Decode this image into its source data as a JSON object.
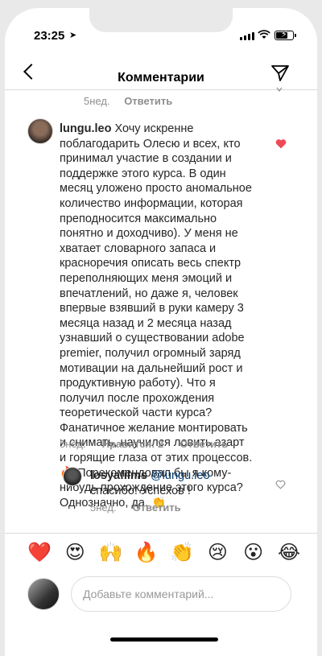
{
  "status": {
    "time": "23:25",
    "battery_level": 0.7
  },
  "header": {
    "title": "Комментарии"
  },
  "prev_comment": {
    "age": "5нед.",
    "reply": "Ответить"
  },
  "comment": {
    "username": "lungu.leo",
    "text": " Хочу искренне поблагодарить Олесю и всех, кто принимал участие в создании и поддержке этого курса. В один месяц уложено просто аномальное количество информации, которая преподносится максимально понятно и доходчиво). У меня не хватает словарного запаса и красноречия описать весь  спектр переполняющих меня эмоций и впечатлений, но даже я, человек впервые взявший в руки камеру 3 месяца назад и 2 месяца назад узнавший о существовании adobe premier, получил огромный заряд мотивации на дальнейший рост и продуктивную работу). Что я получил после прохождения теоретической части курса? Фанатичное желание монтировать и снимать, научился ловить азарт и горящие глаза от этих процессов.🔥 Порекомендовал бы я кому-нибудь прохождение этого курса? Однозначно, да. 👏",
    "age": "5нед.",
    "likes": "Нравится: 2",
    "reply": "Ответить"
  },
  "reply": {
    "username": "losyafilms",
    "mention": "@lungu.leo",
    "text": " спасибо! Успехов !",
    "age": "5нед.",
    "reply": "Ответить"
  },
  "emojis": [
    "❤️",
    "😍",
    "🙌",
    "🔥",
    "👏",
    "😢",
    "😮",
    "😂"
  ],
  "composer": {
    "placeholder": "Добавьте комментарий..."
  },
  "colors": {
    "heart": "#ed4956",
    "mention": "#003569"
  }
}
